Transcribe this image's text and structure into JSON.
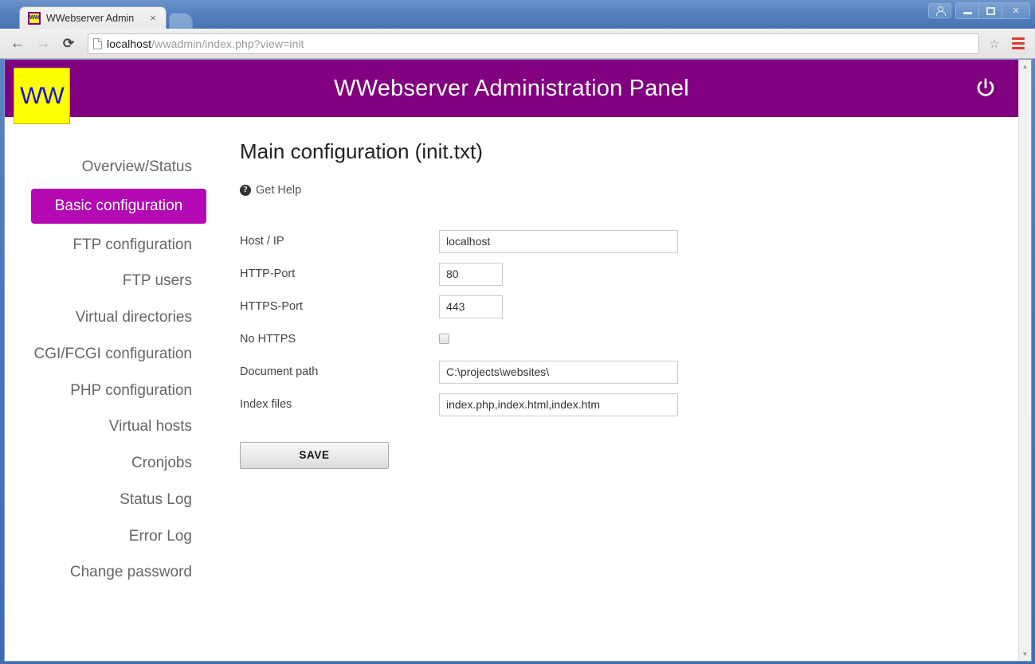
{
  "browser": {
    "tab": {
      "title": "WWebserver Admin",
      "favicon_label": "WW",
      "favicon_name": "wwebserver-favicon",
      "close_glyph": "×"
    },
    "new_tab_name": "new-tab-button",
    "window_controls": {
      "profile_name": "profile-icon",
      "minimize_name": "minimize-button",
      "maximize_name": "maximize-button",
      "close_label": "✕"
    },
    "toolbar": {
      "back_glyph": "←",
      "forward_glyph": "→",
      "reload_glyph": "⟳",
      "url_host": "localhost",
      "url_path": "/wwadmin/index.php?view=init",
      "url_full": "localhost/wwadmin/index.php?view=init",
      "star_glyph": "☆",
      "menu_name": "chrome-menu-icon"
    },
    "scrollbar": {
      "up_glyph": "▲",
      "down_glyph": "▼"
    }
  },
  "app": {
    "logo_text": "WW",
    "title": "WWebserver Administration Panel",
    "power_button_name": "logout-power-icon",
    "colors": {
      "header_purple": "#800080",
      "active_nav_magenta": "#b209b2",
      "logo_yellow": "#ffff00",
      "logo_blue": "#1414d2"
    }
  },
  "sidebar": {
    "items": [
      {
        "label": "Overview/Status",
        "name": "sidebar-item-overview-status",
        "active": false
      },
      {
        "label": "Basic configuration",
        "name": "sidebar-item-basic-configuration",
        "active": true
      },
      {
        "label": "FTP configuration",
        "name": "sidebar-item-ftp-configuration",
        "active": false
      },
      {
        "label": "FTP users",
        "name": "sidebar-item-ftp-users",
        "active": false
      },
      {
        "label": "Virtual directories",
        "name": "sidebar-item-virtual-directories",
        "active": false
      },
      {
        "label": "CGI/FCGI configuration",
        "name": "sidebar-item-cgi-fcgi-configuration",
        "active": false
      },
      {
        "label": "PHP configuration",
        "name": "sidebar-item-php-configuration",
        "active": false
      },
      {
        "label": "Virtual hosts",
        "name": "sidebar-item-virtual-hosts",
        "active": false
      },
      {
        "label": "Cronjobs",
        "name": "sidebar-item-cronjobs",
        "active": false
      },
      {
        "label": "Status Log",
        "name": "sidebar-item-status-log",
        "active": false
      },
      {
        "label": "Error Log",
        "name": "sidebar-item-error-log",
        "active": false
      },
      {
        "label": "Change password",
        "name": "sidebar-item-change-password",
        "active": false
      }
    ]
  },
  "main": {
    "title": "Main configuration (init.txt)",
    "help_link": "Get Help",
    "help_icon_glyph": "?",
    "fields": [
      {
        "label": "Host / IP",
        "name": "host-ip",
        "type": "text",
        "value": "localhost",
        "width": "long"
      },
      {
        "label": "HTTP-Port",
        "name": "http-port",
        "type": "text",
        "value": "80",
        "width": "short"
      },
      {
        "label": "HTTPS-Port",
        "name": "https-port",
        "type": "text",
        "value": "443",
        "width": "short"
      },
      {
        "label": "No HTTPS",
        "name": "no-https",
        "type": "checkbox",
        "value": "",
        "checked": false
      },
      {
        "label": "Document path",
        "name": "document-path",
        "type": "text",
        "value": "C:\\projects\\websites\\",
        "width": "long"
      },
      {
        "label": "Index files",
        "name": "index-files",
        "type": "text",
        "value": "index.php,index.html,index.htm",
        "width": "long"
      }
    ],
    "save_label": "SAVE"
  }
}
